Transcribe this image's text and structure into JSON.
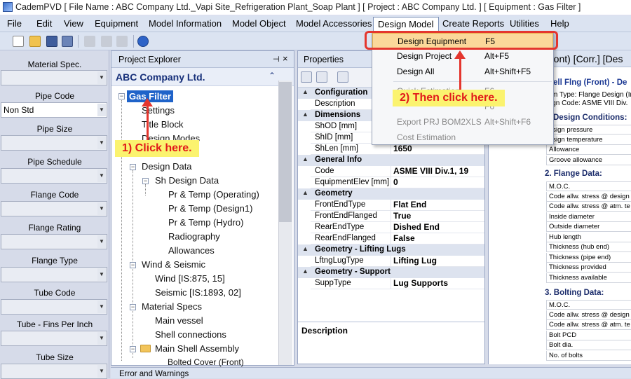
{
  "window": {
    "title": "CademPVD [ File Name : ABC Company Ltd._Vapi Site_Refrigeration Plant_Soap Plant ] [ Project : ABC Company Ltd. ] [ Equipment : Gas Filter ]"
  },
  "menubar": {
    "items": [
      "File",
      "Edit",
      "View",
      "Equipment",
      "Model Information",
      "Model Object",
      "Model Accessories",
      "Design Model",
      "Create Reports",
      "Utilities",
      "Help"
    ]
  },
  "left_panel": {
    "fields": [
      {
        "label": "Material Spec.",
        "value": ""
      },
      {
        "label": "Pipe Code",
        "value": "Non Std"
      },
      {
        "label": "Pipe Size",
        "value": ""
      },
      {
        "label": "Pipe Schedule",
        "value": ""
      },
      {
        "label": "Flange Code",
        "value": ""
      },
      {
        "label": "Flange Rating",
        "value": ""
      },
      {
        "label": "Flange Type",
        "value": ""
      },
      {
        "label": "Tube Code",
        "value": ""
      },
      {
        "label": "Tube - Fins Per Inch",
        "value": ""
      },
      {
        "label": "Tube Size",
        "value": ""
      }
    ]
  },
  "explorer": {
    "title": "Project Explorer",
    "pin": "ᵖ",
    "close": "×",
    "company": "ABC Company Ltd.",
    "collapse": "≈",
    "tree": {
      "root": "Gas Filter",
      "settings": "Settings",
      "title_block": "Title Block",
      "design_modes": "Design Modes",
      "design_data": "Design Data",
      "sh_design_data": "Sh Design Data",
      "pr_op": "Pr & Temp (Operating)",
      "pr_d1": "Pr & Temp (Design1)",
      "pr_hy": "Pr & Temp (Hydro)",
      "radiography": "Radiography",
      "allowances": "Allowances",
      "wind_seismic": "Wind & Seismic",
      "wind": "Wind [IS:875, 15]",
      "seismic": "Seismic [IS:1893, 02]",
      "material_specs": "Material Specs",
      "main_vessel": "Main vessel",
      "shell_conn": "Shell connections",
      "main_shell": "Main Shell Assembly",
      "bolted_cover": "Bolted Cover (Front)"
    }
  },
  "properties": {
    "title": "Properties",
    "rows": [
      {
        "type": "cat",
        "key": "Configuration",
        "value": ""
      },
      {
        "type": "row",
        "key": "Description",
        "value": ""
      },
      {
        "type": "cat",
        "key": "Dimensions",
        "value": ""
      },
      {
        "type": "row",
        "key": "ShOD [mm]",
        "value": ""
      },
      {
        "type": "row",
        "key": "ShID [mm]",
        "value": ""
      },
      {
        "type": "row",
        "key": "ShLen [mm]",
        "value": "1650"
      },
      {
        "type": "cat",
        "key": "General Info",
        "value": ""
      },
      {
        "type": "row",
        "key": "Code",
        "value": "ASME VIII Div.1, 19"
      },
      {
        "type": "row",
        "key": "EquipmentElev [mm]",
        "value": "0"
      },
      {
        "type": "cat",
        "key": "Geometry",
        "value": ""
      },
      {
        "type": "row",
        "key": "FrontEndType",
        "value": "Flat End"
      },
      {
        "type": "row",
        "key": "FrontEndFlanged",
        "value": "True"
      },
      {
        "type": "row",
        "key": "RearEndType",
        "value": "Dished End"
      },
      {
        "type": "row",
        "key": "RearEndFlanged",
        "value": "False"
      },
      {
        "type": "cat",
        "key": "Geometry - Lifting Lugs",
        "value": ""
      },
      {
        "type": "row",
        "key": "LftngLugType",
        "value": "Lifting Lug"
      },
      {
        "type": "cat",
        "key": "Geometry - Support",
        "value": ""
      },
      {
        "type": "row",
        "key": "SuppType",
        "value": "Lug Supports"
      }
    ],
    "description_title": "Description"
  },
  "document": {
    "tab_title": "ront) [Corr.] [Des",
    "heading": "ell Flng (Front) - De",
    "line1": "m Type: Flange Design (Ir",
    "line2": "ign Code: ASME VIII Div.",
    "sec1": "Design Conditions:",
    "sec1_rows": [
      "esign pressure",
      "esign temperature",
      "Allowance",
      "Groove allowance"
    ],
    "sec2": "2. Flange Data:",
    "sec2_rows": [
      "M.O.C.",
      "Code allw. stress @ design",
      "Code allw. stress @ atm. te",
      "Inside diameter",
      "Outside diameter",
      "Hub length",
      "Thickness (hub end)",
      "Thickness (pipe end)",
      "Thickness provided",
      "Thickness available"
    ],
    "sec3": "3. Bolting Data:",
    "sec3_rows": [
      "M.O.C.",
      "Code allw. stress @ design",
      "Code allw. stress @ atm. te",
      "Bolt PCD",
      "Bolt dia.",
      "No. of bolts"
    ]
  },
  "errors_bar": {
    "title": "Error and Warnings"
  },
  "design_menu": {
    "items": [
      {
        "label": "Design Equipment",
        "shortcut": "F5",
        "state": "selected"
      },
      {
        "label": "Design Project",
        "shortcut": "Alt+F5",
        "state": "normal"
      },
      {
        "label": "Design All",
        "shortcut": "Alt+Shift+F5",
        "state": "normal"
      },
      {
        "label": "Quick Estimation",
        "shortcut": "F6",
        "state": "disabled"
      },
      {
        "label": "",
        "shortcut": "F6",
        "state": "disabled"
      },
      {
        "label": "Export PRJ BOM2XLS",
        "shortcut": "Alt+Shift+F6",
        "state": "disabled"
      },
      {
        "label": "Cost Estimation",
        "shortcut": "",
        "state": "disabled"
      }
    ]
  },
  "annotations": {
    "step1": "1) Click here.",
    "step2": "2) Then click here.",
    "highlight_color": "#e4362e",
    "callout_bg": "#fbf36f"
  }
}
